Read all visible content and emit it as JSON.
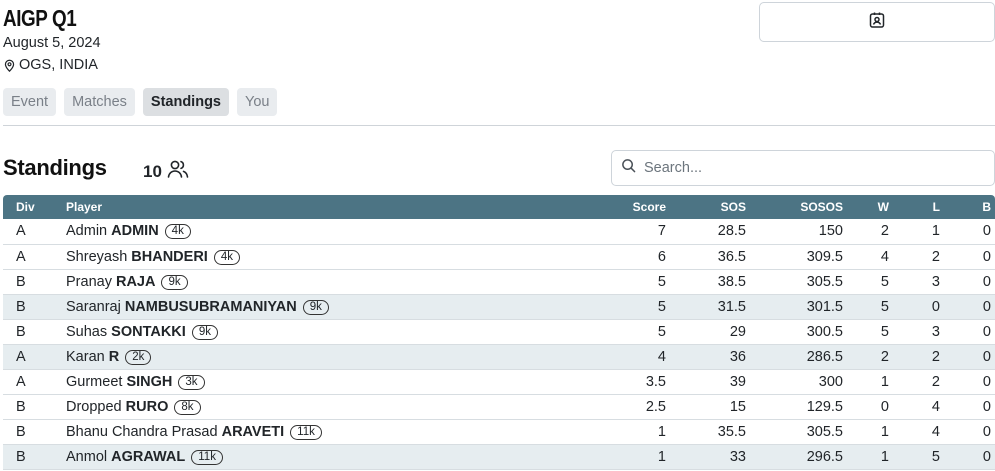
{
  "event": {
    "title": "AIGP Q1",
    "date": "August 5, 2024",
    "location": "OGS, INDIA"
  },
  "icons": {
    "contact": "contact-card-icon",
    "location": "map-pin-icon",
    "players": "users-icon",
    "search": "search-icon"
  },
  "tabs": [
    {
      "label": "Event",
      "active": false
    },
    {
      "label": "Matches",
      "active": false
    },
    {
      "label": "Standings",
      "active": true
    },
    {
      "label": "You",
      "active": false
    }
  ],
  "standings": {
    "title": "Standings",
    "player_count": "10",
    "search_placeholder": "Search...",
    "columns": {
      "div": "Div",
      "player": "Player",
      "score": "Score",
      "sos": "SOS",
      "sosos": "SOSOS",
      "w": "W",
      "l": "L",
      "b": "B"
    },
    "rows": [
      {
        "div": "A",
        "first": "Admin",
        "last": "ADMIN",
        "rank": "4k",
        "score": "7",
        "sos": "28.5",
        "sosos": "150",
        "w": "2",
        "l": "1",
        "b": "0"
      },
      {
        "div": "A",
        "first": "Shreyash",
        "last": "BHANDERI",
        "rank": "4k",
        "score": "6",
        "sos": "36.5",
        "sosos": "309.5",
        "w": "4",
        "l": "2",
        "b": "0"
      },
      {
        "div": "B",
        "first": "Pranay",
        "last": "RAJA",
        "rank": "9k",
        "score": "5",
        "sos": "38.5",
        "sosos": "305.5",
        "w": "5",
        "l": "3",
        "b": "0"
      },
      {
        "div": "B",
        "first": "Saranraj",
        "last": "NAMBUSUBRAMANIYAN",
        "rank": "9k",
        "score": "5",
        "sos": "31.5",
        "sosos": "301.5",
        "w": "5",
        "l": "0",
        "b": "0"
      },
      {
        "div": "B",
        "first": "Suhas",
        "last": "SONTAKKI",
        "rank": "9k",
        "score": "5",
        "sos": "29",
        "sosos": "300.5",
        "w": "5",
        "l": "3",
        "b": "0"
      },
      {
        "div": "A",
        "first": "Karan",
        "last": "R",
        "rank": "2k",
        "score": "4",
        "sos": "36",
        "sosos": "286.5",
        "w": "2",
        "l": "2",
        "b": "0"
      },
      {
        "div": "A",
        "first": "Gurmeet",
        "last": "SINGH",
        "rank": "3k",
        "score": "3.5",
        "sos": "39",
        "sosos": "300",
        "w": "1",
        "l": "2",
        "b": "0"
      },
      {
        "div": "B",
        "first": "Dropped",
        "last": "RURO",
        "rank": "8k",
        "score": "2.5",
        "sos": "15",
        "sosos": "129.5",
        "w": "0",
        "l": "4",
        "b": "0"
      },
      {
        "div": "B",
        "first": "Bhanu Chandra Prasad",
        "last": "ARAVETI",
        "rank": "11k",
        "score": "1",
        "sos": "35.5",
        "sosos": "305.5",
        "w": "1",
        "l": "4",
        "b": "0"
      },
      {
        "div": "B",
        "first": "Anmol",
        "last": "AGRAWAL",
        "rank": "11k",
        "score": "1",
        "sos": "33",
        "sosos": "296.5",
        "w": "1",
        "l": "5",
        "b": "0"
      }
    ]
  }
}
